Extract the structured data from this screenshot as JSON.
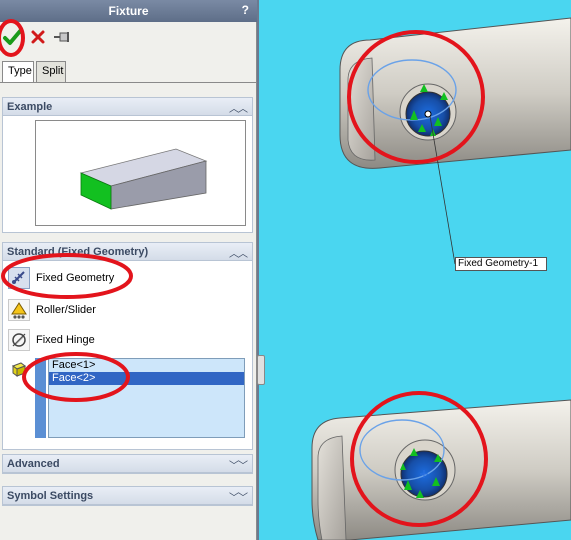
{
  "panel": {
    "title": "Fixture",
    "help": "?",
    "toolbar": {
      "ok_icon": "checkmark-icon",
      "cancel_icon": "x-icon",
      "pin_icon": "pushpin-icon"
    },
    "tabs": [
      {
        "label": "Type",
        "active": true
      },
      {
        "label": "Split",
        "active": false
      }
    ],
    "example": {
      "title": "Example",
      "collapse_icon": "chevron-up-icon"
    },
    "standard": {
      "title": "Standard (Fixed Geometry)",
      "collapse_icon": "chevron-up-icon",
      "fixture_types": [
        {
          "label": "Fixed Geometry",
          "icon": "fixed-geometry-icon",
          "selected": true
        },
        {
          "label": "Roller/Slider",
          "icon": "roller-slider-icon",
          "selected": false
        },
        {
          "label": "Fixed Hinge",
          "icon": "fixed-hinge-icon",
          "selected": false
        }
      ],
      "faces": [
        {
          "label": "Face<1>",
          "selected": false
        },
        {
          "label": "Face<2>",
          "selected": true
        }
      ]
    },
    "advanced": {
      "title": "Advanced",
      "expand_icon": "chevron-down-icon"
    },
    "symbol_settings": {
      "title": "Symbol Settings",
      "expand_icon": "chevron-down-icon"
    }
  },
  "viewport": {
    "callout": "Fixed Geometry-1"
  },
  "colors": {
    "viewport_bg": "#4ad6f0",
    "annotation_red": "#e3141c",
    "fixture_green": "#12c020"
  }
}
